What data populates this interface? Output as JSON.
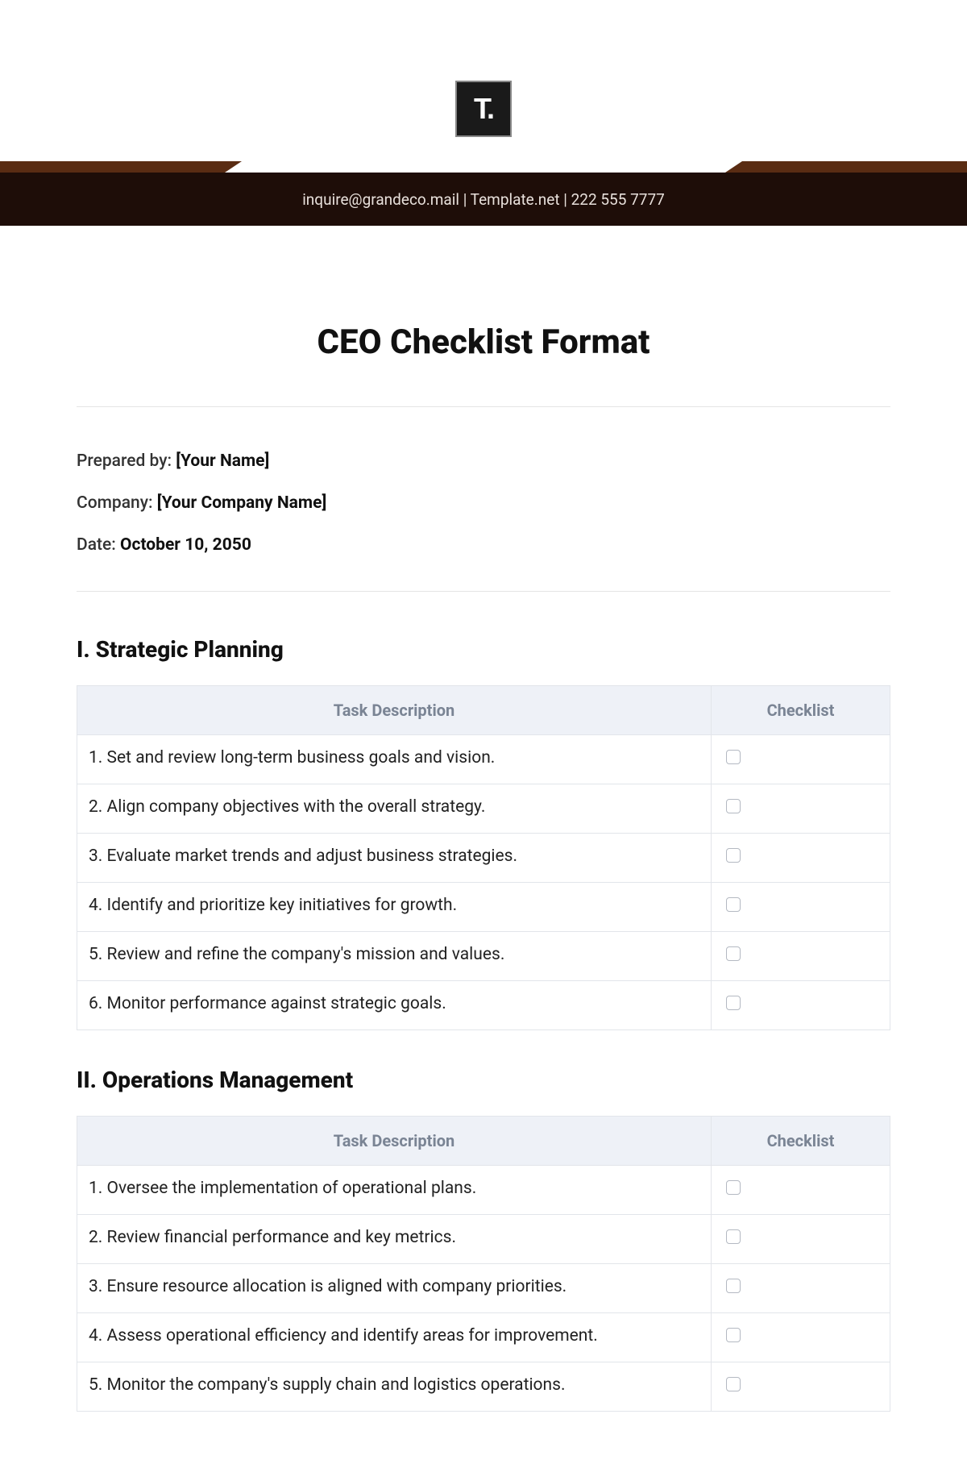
{
  "logo_text": "T.",
  "header_contact": "inquire@grandeco.mail  |  Template.net  |  222 555 7777",
  "title": "CEO Checklist Format",
  "meta": {
    "prepared_label": "Prepared by: ",
    "prepared_value": "[Your Name]",
    "company_label": "Company: ",
    "company_value": "[Your Company Name]",
    "date_label": "Date: ",
    "date_value": "October 10, 2050"
  },
  "table_headers": {
    "task": "Task Description",
    "check": "Checklist"
  },
  "sections": [
    {
      "heading": "I. Strategic Planning",
      "rows": [
        "1. Set and review long-term business goals and vision.",
        "2. Align company objectives with the overall strategy.",
        "3. Evaluate market trends and adjust business strategies.",
        "4. Identify and prioritize key initiatives for growth.",
        "5. Review and refine the company's mission and values.",
        "6. Monitor performance against strategic goals."
      ]
    },
    {
      "heading": "II. Operations Management",
      "rows": [
        "1. Oversee the implementation of operational plans.",
        "2. Review financial performance and key metrics.",
        "3. Ensure resource allocation is aligned with company priorities.",
        "4. Assess operational efficiency and identify areas for improvement.",
        "5. Monitor the company's supply chain and logistics operations."
      ]
    }
  ]
}
